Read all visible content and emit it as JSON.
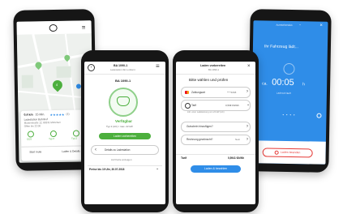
{
  "phone_map": {
    "marker_count": "4",
    "card": {
      "distance": "0,4 km",
      "time": "15 Min.",
      "rating_stars": "★★★★★",
      "rating_count": "(4)",
      "address_1": "Ladestation Bahnhof",
      "address_2": "Musterstraße 12, 80331 München",
      "hours": "Offen bis 22:00",
      "connectors": [
        "CCS",
        "Typ 2",
        "Typ 2"
      ],
      "btn_left": "Start route",
      "btn_right": "Laden & Details"
    }
  },
  "phone_detail": {
    "header_title": "BA 1090-1",
    "header_sub": "Ladestation 3km entfernt",
    "station_id": "BA 1090-1",
    "status": "Verfügbar",
    "status_detail": "Typ 2 (AC) / max. 22 kW",
    "cta": "Laden vorbereiten",
    "route_row": "Details zu Ladestation",
    "link": "Auf Karte anzeigen",
    "footer": "Preise bis 19 Uhr, 30.07.2018"
  },
  "phone_prepare": {
    "header_title": "Laden vorbereiten",
    "header_sub": "BA 1090-1",
    "heading": "Bitte wählen und prüfen",
    "payment_label": "Zahlungsart",
    "payment_value": "****4668",
    "tariff_label": "Tarif",
    "tariff_value": "0,59€ €/kWh",
    "note": "inkl. einer Ladeleistung von 22 kW (AC)",
    "voucher": "Gutschein hinzufügen?",
    "invoice_label": "Rechnung gewünscht?",
    "invoice_value": "Nein",
    "total_label": "Tarif",
    "total_value": "0,5941 €/kWh",
    "cta": "Laden & bezahlen"
  },
  "phone_charging": {
    "header": "Ausstehendes",
    "title": "Ihr Fahrzeug lädt...",
    "time_prefix": "ca.",
    "time_value": "00:05",
    "time_unit": "h",
    "sub": "Ladezeit läuft",
    "cta": "Laden beenden"
  },
  "colors": {
    "green": "#4caf3d",
    "blue": "#2f8de8",
    "red": "#e53935"
  }
}
